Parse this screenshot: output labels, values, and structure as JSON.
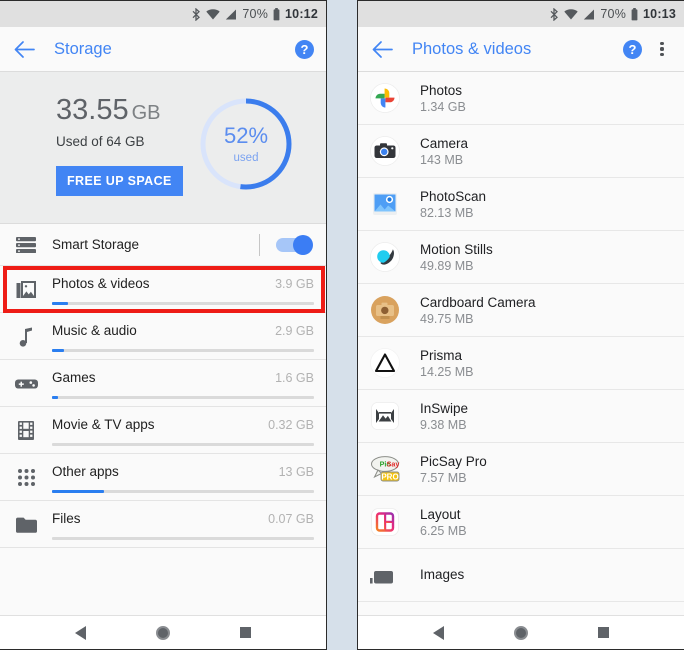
{
  "left_phone": {
    "statusbar": {
      "bluetooth_icon": "bluetooth-icon",
      "wifi_icon": "wifi-icon",
      "signal_icon": "cell-signal-icon",
      "battery_text": "70%",
      "battery_icon": "battery-icon",
      "time": "10:12"
    },
    "appbar": {
      "back_icon": "back-arrow-icon",
      "title": "Storage",
      "help_label": "?"
    },
    "summary": {
      "used_amount": "33.55",
      "used_unit": "GB",
      "used_of": "Used of 64 GB",
      "free_up_label": "FREE UP SPACE",
      "ring_percent_label": "52%",
      "ring_used_label": "used",
      "ring_percent_value": 52,
      "ring_track_color": "#d9e4fb",
      "ring_fill_color": "#3b7ded"
    },
    "smart_storage": {
      "icon": "smart-storage-icon",
      "label": "Smart Storage",
      "toggle_on": "true"
    },
    "categories": [
      {
        "icon": "photos-videos-icon",
        "name": "Photos & videos",
        "size": "3.9 GB",
        "fill_pct": 6,
        "highlighted": "true"
      },
      {
        "icon": "music-audio-icon",
        "name": "Music & audio",
        "size": "2.9 GB",
        "fill_pct": 4.5,
        "highlighted": "false"
      },
      {
        "icon": "games-icon",
        "name": "Games",
        "size": "1.6 GB",
        "fill_pct": 2.4,
        "highlighted": "false"
      },
      {
        "icon": "movie-tv-apps-icon",
        "name": "Movie & TV apps",
        "size": "0.32 GB",
        "fill_pct": 0,
        "highlighted": "false"
      },
      {
        "icon": "other-apps-icon",
        "name": "Other apps",
        "size": "13 GB",
        "fill_pct": 20,
        "highlighted": "false"
      },
      {
        "icon": "files-icon",
        "name": "Files",
        "size": "0.07 GB",
        "fill_pct": 0,
        "highlighted": "false"
      }
    ],
    "navbar": {
      "back": "nav-back-icon",
      "home": "nav-home-icon",
      "recents": "nav-recents-icon"
    }
  },
  "right_phone": {
    "statusbar": {
      "bluetooth_icon": "bluetooth-icon",
      "wifi_icon": "wifi-icon",
      "signal_icon": "cell-signal-icon",
      "battery_text": "70%",
      "battery_icon": "battery-icon",
      "time": "10:13"
    },
    "appbar": {
      "back_icon": "back-arrow-icon",
      "title": "Photos & videos",
      "help_label": "?",
      "overflow_icon": "kebab-menu-icon"
    },
    "apps": [
      {
        "icon": "google-photos-icon",
        "name": "Photos",
        "size": "1.34 GB"
      },
      {
        "icon": "camera-icon",
        "name": "Camera",
        "size": "143 MB"
      },
      {
        "icon": "photoscan-icon",
        "name": "PhotoScan",
        "size": "82.13 MB"
      },
      {
        "icon": "motion-stills-icon",
        "name": "Motion Stills",
        "size": "49.89 MB"
      },
      {
        "icon": "cardboard-camera-icon",
        "name": "Cardboard Camera",
        "size": "49.75 MB"
      },
      {
        "icon": "prisma-icon",
        "name": "Prisma",
        "size": "14.25 MB"
      },
      {
        "icon": "inswipe-icon",
        "name": "InSwipe",
        "size": "9.38 MB"
      },
      {
        "icon": "picsay-pro-icon",
        "name": "PicSay Pro",
        "size": "7.57 MB"
      },
      {
        "icon": "layout-icon",
        "name": "Layout",
        "size": "6.25 MB"
      },
      {
        "icon": "images-icon",
        "name": "Images",
        "size": ""
      }
    ],
    "navbar": {
      "back": "nav-back-icon",
      "home": "nav-home-icon",
      "recents": "nav-recents-icon"
    }
  },
  "theme": {
    "accent": "#4285f4",
    "highlight_box_color": "#ee1c16",
    "gap_color": "#d6e0ea"
  }
}
